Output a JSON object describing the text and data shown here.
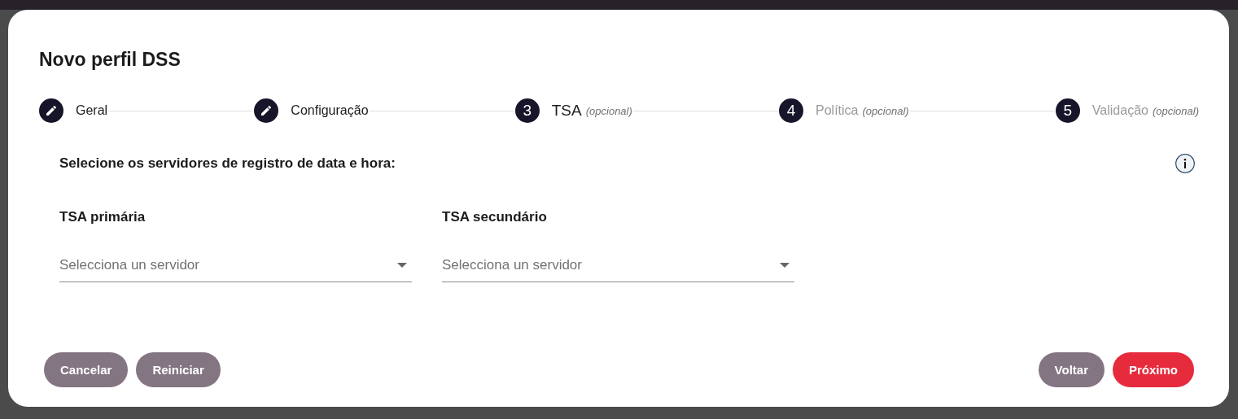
{
  "dialog": {
    "title": "Novo perfil DSS",
    "steps": [
      {
        "kind": "done",
        "label": "Geral",
        "active": false,
        "disabled": false
      },
      {
        "kind": "done",
        "label": "Configuração",
        "active": false,
        "disabled": false
      },
      {
        "kind": "number",
        "number": "3",
        "label": "TSA",
        "note": "(opcional)",
        "active": true,
        "disabled": false
      },
      {
        "kind": "number",
        "number": "4",
        "label": "Política",
        "note": "(opcional)",
        "active": false,
        "disabled": true
      },
      {
        "kind": "number",
        "number": "5",
        "label": "Validação",
        "note": "(opcional)",
        "active": false,
        "disabled": true
      }
    ],
    "heading": "Selecione os servidores de registro de data e hora:",
    "fields": [
      {
        "label": "TSA primária",
        "placeholder": "Selecciona un servidor"
      },
      {
        "label": "TSA secundário",
        "placeholder": "Selecciona un servidor"
      }
    ],
    "left_buttons": [
      {
        "label": "Cancelar",
        "kind": "secondary"
      },
      {
        "label": "Reiniciar",
        "kind": "secondary"
      }
    ],
    "right_buttons": [
      {
        "label": "Voltar",
        "kind": "secondary"
      },
      {
        "label": "Próximo",
        "kind": "primary"
      }
    ]
  }
}
